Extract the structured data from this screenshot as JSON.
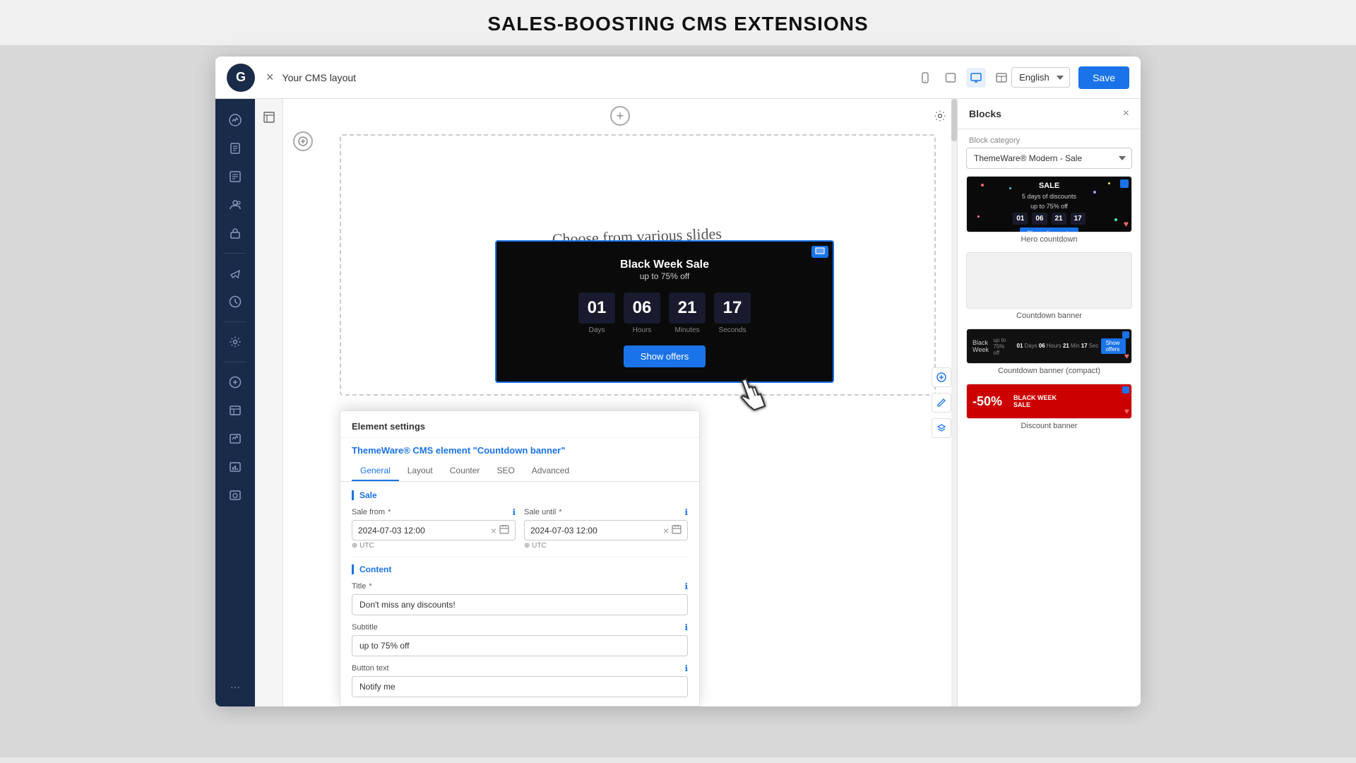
{
  "page": {
    "title": "SALES-BOOSTING CMS EXTENSIONS"
  },
  "header": {
    "logo": "G",
    "close_label": "×",
    "cms_title": "Your CMS layout",
    "devices": [
      {
        "id": "mobile",
        "icon": "📱"
      },
      {
        "id": "tablet",
        "icon": "📟"
      },
      {
        "id": "desktop",
        "icon": "🖥"
      },
      {
        "id": "layout",
        "icon": "▦"
      }
    ],
    "language": "English",
    "save_label": "Save"
  },
  "sidebar": {
    "icons": [
      {
        "id": "analytics",
        "label": "analytics-icon"
      },
      {
        "id": "pages",
        "label": "pages-icon"
      },
      {
        "id": "content",
        "label": "content-icon"
      },
      {
        "id": "users",
        "label": "users-icon"
      },
      {
        "id": "products",
        "label": "products-icon"
      },
      {
        "id": "marketing",
        "label": "marketing-icon"
      },
      {
        "id": "settings",
        "label": "settings-icon"
      },
      {
        "id": "addons",
        "label": "addons-icon"
      },
      {
        "id": "reports1",
        "label": "reports1-icon"
      },
      {
        "id": "reports2",
        "label": "reports2-icon"
      },
      {
        "id": "reports3",
        "label": "reports3-icon"
      },
      {
        "id": "reports4",
        "label": "reports4-icon"
      }
    ]
  },
  "canvas": {
    "handwritten_text": "Choose from various slides\nwith extremely extensive\nconfiguration options",
    "arrow": "→"
  },
  "countdown_banner": {
    "title": "Black Week Sale",
    "subtitle": "up to 75% off",
    "units": [
      {
        "value": "01",
        "label": "Days"
      },
      {
        "value": "06",
        "label": "Hours"
      },
      {
        "value": "21",
        "label": "Minutes"
      },
      {
        "value": "17",
        "label": "Seconds"
      }
    ],
    "cta": "Show offers"
  },
  "settings_panel": {
    "header": "Element settings",
    "plugin_title": "ThemeWare® CMS element \"Countdown banner\"",
    "tabs": [
      "General",
      "Layout",
      "Counter",
      "SEO",
      "Advanced"
    ],
    "active_tab": "General",
    "sections": {
      "sale": {
        "label": "Sale",
        "sale_from": {
          "label": "Sale from",
          "required": true,
          "value": "2024-07-03 12:00",
          "timezone": "UTC"
        },
        "sale_until": {
          "label": "Sale until",
          "required": true,
          "value": "2024-07-03 12:00",
          "timezone": "UTC"
        }
      },
      "content": {
        "label": "Content",
        "title": {
          "label": "Title",
          "required": true,
          "value": "Don't miss any discounts!"
        },
        "subtitle": {
          "label": "Subtitle",
          "value": "up to 75% off"
        },
        "button_text": {
          "label": "Button text",
          "value": "Notify me"
        }
      }
    }
  },
  "right_panel": {
    "title": "Blocks",
    "close_label": "×",
    "category_label": "Block category",
    "category_value": "ThemeWare® Modern - Sale",
    "blocks": [
      {
        "id": "hero-countdown",
        "label": "Hero countdown",
        "type": "hero"
      },
      {
        "id": "countdown-banner",
        "label": "Countdown banner",
        "type": "empty"
      },
      {
        "id": "countdown-banner-compact",
        "label": "Countdown banner (compact)",
        "type": "compact"
      },
      {
        "id": "discount-banner",
        "label": "Discount banner",
        "type": "discount"
      }
    ]
  }
}
